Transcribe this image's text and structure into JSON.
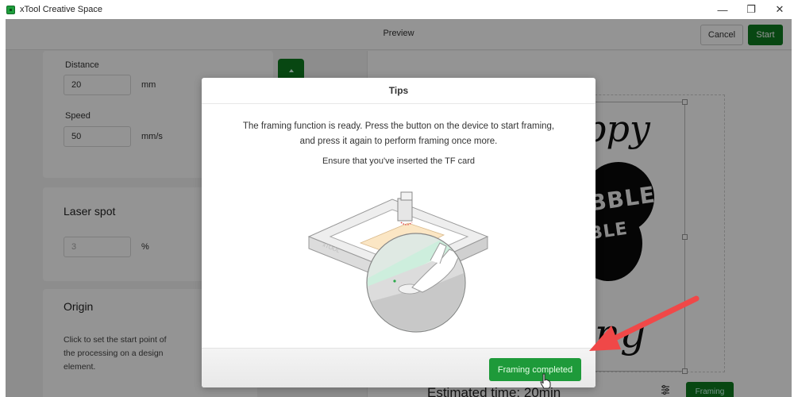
{
  "window": {
    "title": "xTool Creative Space",
    "controls": {
      "minimize": "—",
      "restore": "❐",
      "close": "✕"
    }
  },
  "topbar": {
    "title": "Preview",
    "cancel_label": "Cancel",
    "start_label": "Start"
  },
  "left_panel": {
    "distance": {
      "label": "Distance",
      "value": "20",
      "unit": "mm"
    },
    "speed": {
      "label": "Speed",
      "value": "50",
      "unit": "mm/s"
    },
    "laser_spot": {
      "title": "Laser spot",
      "value": "3",
      "unit": "%"
    },
    "origin": {
      "title": "Origin",
      "description": "Click to set the start point of the processing on a design element."
    }
  },
  "canvas": {
    "design_text_top": "ppy",
    "design_blob_text_1": "BBLE",
    "design_blob_text_2": "BLE",
    "design_text_bottom": "ring",
    "estimated_time": "Estimated time: 20min",
    "framing_label": "Framing"
  },
  "modal": {
    "title": "Tips",
    "message_line1": "The framing function is ready. Press the button on the device to start framing,",
    "message_line2": "and press it again to perform framing once more.",
    "note": "Ensure that you've inserted the TF card",
    "illustration_brand": "xTOOL",
    "confirm_label": "Framing completed"
  },
  "colors": {
    "accent_green": "#0e7a1f",
    "button_green": "#1e9a3a",
    "annotation_red": "#f04848"
  }
}
